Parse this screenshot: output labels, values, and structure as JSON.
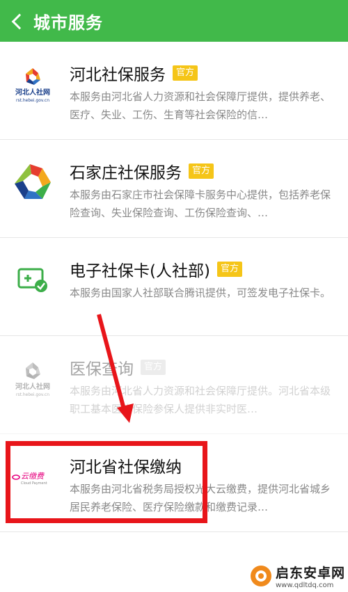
{
  "header": {
    "title": "城市服务"
  },
  "services": [
    {
      "title": "河北社保服务",
      "badge": "官方",
      "desc": "本服务由河北省人力资源和社会保障厅提供，提供养老、医疗、失业、工伤、生育等社会保险的信…",
      "icon": "hebei-rst-icon",
      "logo_caption": "河北人社网",
      "logo_url": "rst.hebei.gov.cn"
    },
    {
      "title": "石家庄社保服务",
      "badge": "官方",
      "desc": "本服务由石家庄市社会保障卡服务中心提供，包括养老保险查询、失业保险查询、工伤保险查询、…",
      "icon": "shijiazhuang-icon"
    },
    {
      "title": "电子社保卡(人社部)",
      "badge": "官方",
      "desc": "本服务由国家人社部联合腾讯提供，可签发电子社保卡。",
      "icon": "e-card-icon"
    },
    {
      "title": "医保查询",
      "badge": "官方",
      "desc": "本服务由河北省人力资源和社会保障厅提供。河北省本级职工基本医疗保险参保人提供非实时医…",
      "icon": "hebei-rst-icon",
      "logo_caption": "河北人社网",
      "logo_url": "rst.hebei.gov.cn"
    },
    {
      "title": "河北省社保缴纳",
      "badge": "",
      "desc": "本服务由河北省税务局授权光大云缴费，提供河北省城乡居民养老保险、医疗保险缴款和缴费记录…",
      "icon": "yunjiaofei-icon",
      "logo_caption": "云缴费",
      "logo_sub": "Cloud Payment"
    }
  ],
  "watermark": {
    "name": "启东安卓网",
    "url": "www.qdltdq.com"
  },
  "colors": {
    "header": "#41b94a",
    "badge": "#f5c518",
    "highlight": "#e8151a"
  }
}
